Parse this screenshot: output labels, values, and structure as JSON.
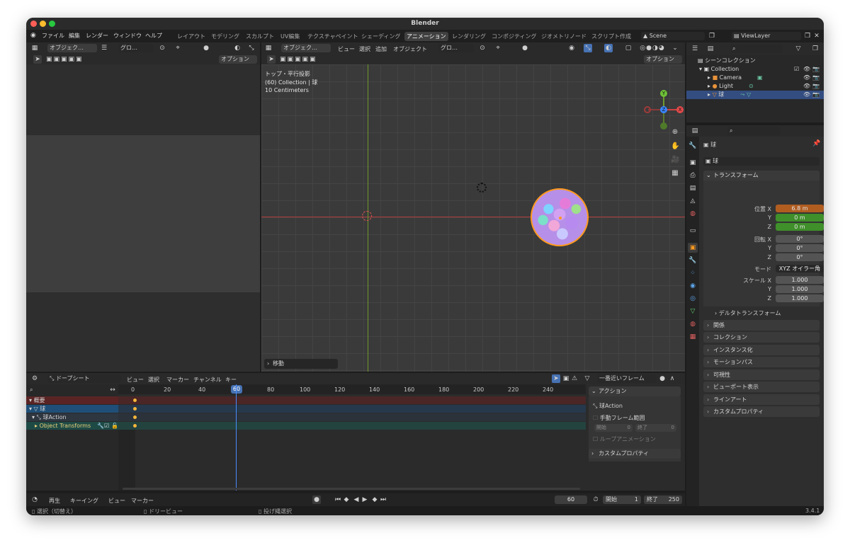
{
  "window": {
    "title": "Blender",
    "version": "3.4.1"
  },
  "menu": [
    "ファイル",
    "編集",
    "レンダー",
    "ウィンドウ",
    "ヘルプ"
  ],
  "workspace_tabs": [
    "レイアウト",
    "モデリング",
    "スカルプト",
    "UV編集",
    "テクスチャペイント",
    "シェーディング",
    "アニメーション",
    "レンダリング",
    "コンポジティング",
    "ジオメトリノード",
    "スクリプト作成"
  ],
  "active_tab": "アニメーション",
  "scene_name": "Scene",
  "view_layer": "ViewLayer",
  "left_panel": {
    "mode": "オブジェク…",
    "transform": "グロ…",
    "options": "オプション"
  },
  "viewport": {
    "mode": "オブジェク…",
    "menus": [
      "ビュー",
      "選択",
      "追加",
      "オブジェクト"
    ],
    "transform": "グロ…",
    "options": "オプション",
    "info_line1": "トップ・平行投影",
    "info_line2": "(60) Collection | 球",
    "info_line3": "10 Centimeters",
    "operator_panel": "移動",
    "gizmo": {
      "y": "Y",
      "z": "Z",
      "x": "X"
    }
  },
  "outliner": {
    "root": "シーンコレクション",
    "collection": "Collection",
    "items": [
      "Camera",
      "Light",
      "球"
    ]
  },
  "properties": {
    "object_name": "球",
    "data_name": "球",
    "transform_title": "トランスフォーム",
    "location_label": "位置 X",
    "location": [
      "6.8 m",
      "0 m",
      "0 m"
    ],
    "rotation_label": "回転 X",
    "rotation": [
      "0°",
      "0°",
      "0°"
    ],
    "mode_label": "モード",
    "mode_value": "XYZ オイラー角",
    "scale_label": "スケール X",
    "scale": [
      "1.000",
      "1.000",
      "1.000"
    ],
    "axis_y": "Y",
    "axis_z": "Z",
    "delta": "デルタトランスフォーム",
    "sections": [
      "関係",
      "コレクション",
      "インスタンス化",
      "モーションパス",
      "可視性",
      "ビューポート表示",
      "ラインアート",
      "カスタムプロパティ"
    ]
  },
  "dopesheet": {
    "editor_mode": "ドープシート",
    "menus": [
      "ビュー",
      "選択",
      "マーカー",
      "チャンネル",
      "キー"
    ],
    "snap": "一番近いフレーム",
    "ruler": [
      "0",
      "20",
      "40",
      "60",
      "80",
      "100",
      "120",
      "140",
      "160",
      "180",
      "200",
      "220",
      "240"
    ],
    "current_frame": "60",
    "channels": [
      "概要",
      "球",
      "球Action",
      "Object Transforms"
    ],
    "action_panel": {
      "title": "アクション",
      "action_name": "球Action",
      "manual_range": "手動フレーム範囲",
      "start_label": "開始",
      "start_value": "0",
      "end_label": "終了",
      "end_value": "0",
      "loop": "ループアニメーション",
      "custom_props": "カスタムプロパティ"
    }
  },
  "timeline": {
    "menus": [
      "再生",
      "キーイング",
      "ビュー",
      "マーカー"
    ],
    "frame": "60",
    "start_label": "開始",
    "start": "1",
    "end_label": "終了",
    "end": "250"
  },
  "statusbar": {
    "select": "選択（切替え）",
    "pan": "ドリービュー",
    "lasso": "投げ縄選択"
  }
}
